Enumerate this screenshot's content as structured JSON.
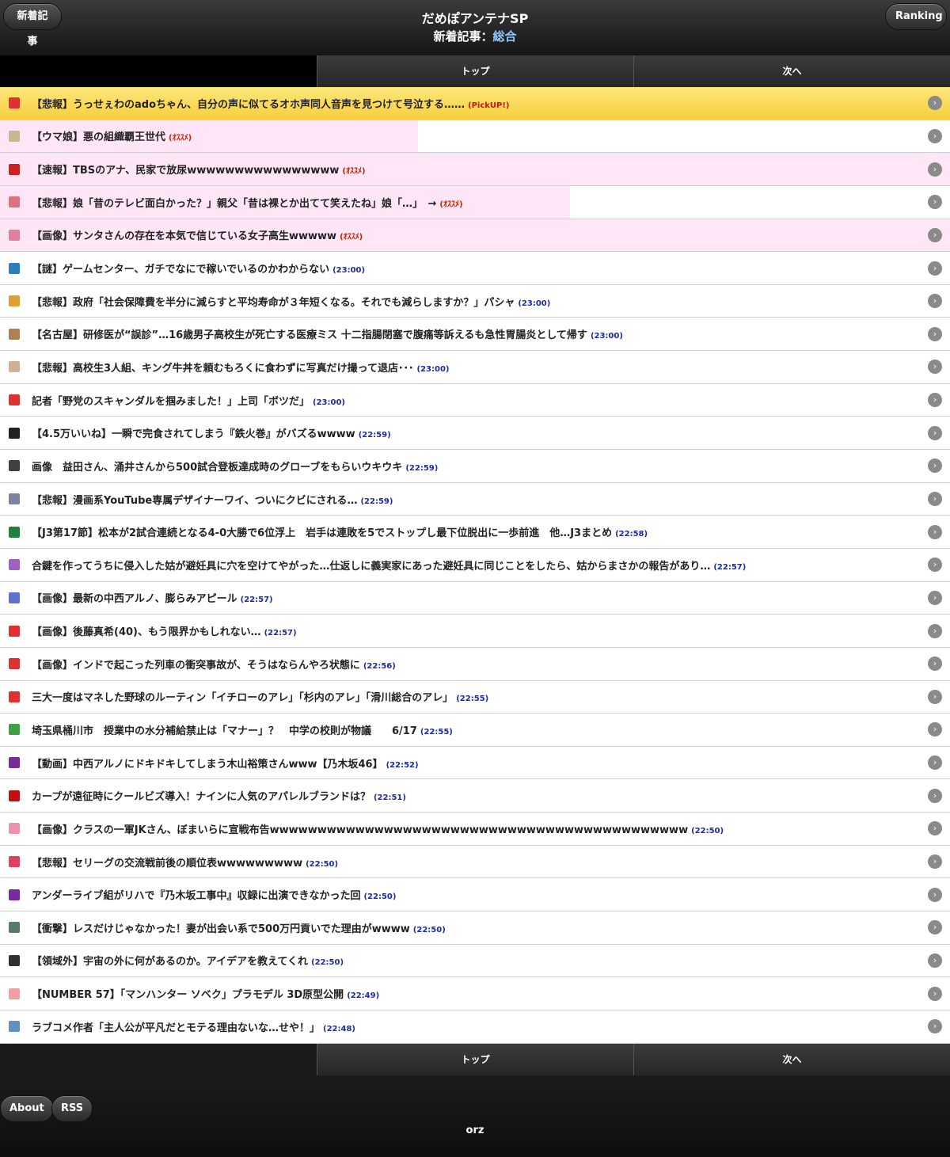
{
  "header": {
    "left_button": "新着記事",
    "right_button": "Ranking",
    "title": "だめぽアンテナSP",
    "subtitle_prefix": "新着記事：",
    "subtitle_category": "総合"
  },
  "nav": {
    "top_label": "トップ",
    "next_label": "次へ"
  },
  "articles": [
    {
      "title": "【悲報】うっせぇわのadoちゃん、自分の声に似てるオホ声同人音声を見つけて号泣する……",
      "meta": "(PickUP!)",
      "kind": "pickup",
      "icon_color": "#e03030",
      "highlight": 1.0
    },
    {
      "title": "【ウマ娘】悪の組織覇王世代",
      "meta": "(ｵｽｽﾒ)",
      "kind": "rec",
      "icon_color": "#c8b890",
      "highlight": 0.44
    },
    {
      "title": "【速報】TBSのアナ、民家で放尿wwwwwwwwwwwwwwww",
      "meta": "(ｵｽｽﾒ)",
      "kind": "rec",
      "icon_color": "#d02020",
      "highlight": 1.0
    },
    {
      "title": "【悲報】娘「昔のテレビ面白かった？」親父「昔は裸とか出てて笑えたね」娘「…」　→",
      "meta": "(ｵｽｽﾒ)",
      "kind": "rec",
      "icon_color": "#e07080",
      "highlight": 0.6
    },
    {
      "title": "【画像】サンタさんの存在を本気で信じている女子高生wwwww",
      "meta": "(ｵｽｽﾒ)",
      "kind": "rec",
      "icon_color": "#e080a0",
      "highlight": 1.0
    },
    {
      "title": "【謎】ゲームセンター、ガチでなにで稼いでいるのかわからない",
      "meta": "(23:00)",
      "kind": "time",
      "icon_color": "#2a7fc0",
      "highlight": 0
    },
    {
      "title": "【悲報】政府「社会保障費を半分に減らすと平均寿命が３年短くなる。それでも減らしますか？」パシャ",
      "meta": "(23:00)",
      "kind": "time",
      "icon_color": "#e0a030",
      "highlight": 0
    },
    {
      "title": "【名古屋】研修医が“誤診”…16歳男子高校生が死亡する医療ミス 十二指腸閉塞で腹痛等訴えるも急性胃腸炎として帰す",
      "meta": "(23:00)",
      "kind": "time",
      "icon_color": "#b08050",
      "highlight": 0
    },
    {
      "title": "【悲報】高校生3人組、キング牛丼を頼むもろくに食わずに写真だけ撮って退店･･･",
      "meta": "(23:00)",
      "kind": "time",
      "icon_color": "#d0b090",
      "highlight": 0
    },
    {
      "title": "記者「野党のスキャンダルを掴みました！」上司「ボツだ」",
      "meta": "(23:00)",
      "kind": "time",
      "icon_color": "#e03030",
      "highlight": 0
    },
    {
      "title": "【4.5万いいね】一瞬で完食されてしまう『鉄火巻』がバズるwwww",
      "meta": "(22:59)",
      "kind": "time",
      "icon_color": "#222222",
      "highlight": 0
    },
    {
      "title": "画像　益田さん、涌井さんから500試合登板達成時のグローブをもらいウキウキ",
      "meta": "(22:59)",
      "kind": "time",
      "icon_color": "#404040",
      "highlight": 0
    },
    {
      "title": "【悲報】漫画系YouTube専属デザイナーワイ、ついにクビにされる…",
      "meta": "(22:59)",
      "kind": "time",
      "icon_color": "#8080a0",
      "highlight": 0
    },
    {
      "title": "【J3第17節】松本が2試合連続となる4-0大勝で6位浮上　岩手は連敗を5でストップし最下位脱出に一歩前進　他…J3まとめ",
      "meta": "(22:58)",
      "kind": "time",
      "icon_color": "#208040",
      "highlight": 0
    },
    {
      "title": "合鍵を作ってうちに侵入した姑が避妊具に穴を空けてやがった…仕返しに義実家にあった避妊具に同じことをしたら、姑からまさかの報告があり…",
      "meta": "(22:57)",
      "kind": "time",
      "icon_color": "#a060c0",
      "highlight": 0
    },
    {
      "title": "【画像】最新の中西アルノ、膨らみアピール",
      "meta": "(22:57)",
      "kind": "time",
      "icon_color": "#6070d0",
      "highlight": 0
    },
    {
      "title": "【画像】後藤真希(40)、もう限界かもしれない…",
      "meta": "(22:57)",
      "kind": "time",
      "icon_color": "#e03030",
      "highlight": 0
    },
    {
      "title": "【画像】インドで起こった列車の衝突事故が、そうはならんやろ状態に",
      "meta": "(22:56)",
      "kind": "time",
      "icon_color": "#e03030",
      "highlight": 0
    },
    {
      "title": "三大一度はマネした野球のルーティン「イチローのアレ」「杉内のアレ」「滑川総合のアレ」",
      "meta": "(22:55)",
      "kind": "time",
      "icon_color": "#e03030",
      "highlight": 0
    },
    {
      "title": "埼玉県桶川市　授業中の水分補給禁止は「マナー」？　中学の校則が物議　　6/17",
      "meta": "(22:55)",
      "kind": "time",
      "icon_color": "#40a040",
      "highlight": 0
    },
    {
      "title": "【動画】中西アルノにドキドキしてしまう木山裕策さんwww【乃木坂46】",
      "meta": "(22:52)",
      "kind": "time",
      "icon_color": "#7a2a9a",
      "highlight": 0
    },
    {
      "title": "カープが遠征時にクールビズ導入！ナインに人気のアパレルブランドは？",
      "meta": "(22:51)",
      "kind": "time",
      "icon_color": "#c01010",
      "highlight": 0
    },
    {
      "title": "【画像】クラスの一軍JKさん、ぼまいらに宣戦布告wwwwwwwwwwwwwwwwwwwwwwwwwwwwwwwwwwwwwwwwwwww",
      "meta": "(22:50)",
      "kind": "time",
      "icon_color": "#f090b0",
      "highlight": 0
    },
    {
      "title": "【悲報】セリーグの交流戦前後の順位表wwwwwwwww",
      "meta": "(22:50)",
      "kind": "time",
      "icon_color": "#e04060",
      "highlight": 0
    },
    {
      "title": "アンダーライブ組がリハで『乃木坂工事中』収録に出演できなかった回",
      "meta": "(22:50)",
      "kind": "time",
      "icon_color": "#7a2a9a",
      "highlight": 0
    },
    {
      "title": "【衝撃】レスだけじゃなかった！妻が出会い系で500万円貢いでた理由がwwww",
      "meta": "(22:50)",
      "kind": "time",
      "icon_color": "#5a7a6a",
      "highlight": 0
    },
    {
      "title": "【領域外】宇宙の外に何があるのか。アイデアを教えてくれ",
      "meta": "(22:50)",
      "kind": "time",
      "icon_color": "#303030",
      "highlight": 0
    },
    {
      "title": "【NUMBER 57】「マンハンター ソベク」プラモデル 3D原型公開",
      "meta": "(22:49)",
      "kind": "time",
      "icon_color": "#f0a0a0",
      "highlight": 0
    },
    {
      "title": "ラブコメ作者「主人公が平凡だとモテる理由ないな…せや！」",
      "meta": "(22:48)",
      "kind": "time",
      "icon_color": "#6090c0",
      "highlight": 0
    }
  ],
  "footer": {
    "about_label": "About",
    "rss_label": "RSS",
    "orz": "orz"
  },
  "colors": {
    "pickup_bg": "#f9d74e",
    "recommend_bg": "#ffe6f6",
    "time_text": "#1a2aa8",
    "recommend_text": "#cc2200",
    "header_bg": "#1e1e1e",
    "subtitle_accent": "#8ec7ff"
  },
  "icons": {
    "row_arrow": "chevron-right-circle-icon"
  }
}
